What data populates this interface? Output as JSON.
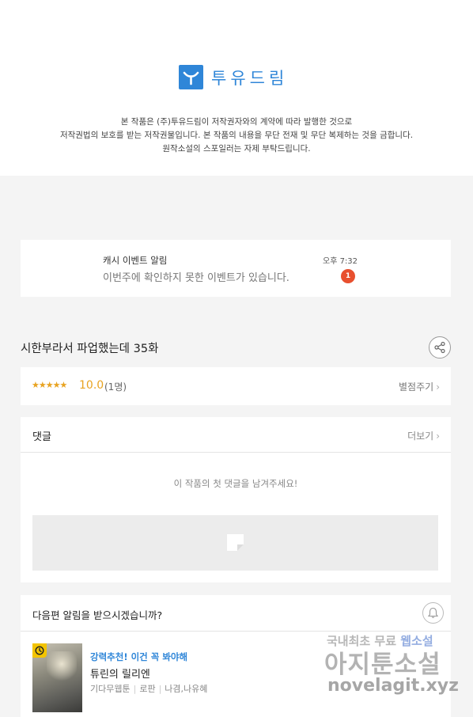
{
  "brand": {
    "logo_text": "투유드림",
    "color": "#2f86d8",
    "icon": "y-mark-icon"
  },
  "copyright": {
    "line1": "본 작품은 (주)투유드림이 저작권자와의 계약에 따라 발행한 것으로",
    "line2": "저작권법의 보호를 받는 저작권물입니다. 본 작품의 내용을 무단 전재 및 무단 복제하는 것을 금합니다.",
    "line3": "원작소설의 스포일러는 자제 부탁드립니다."
  },
  "notification": {
    "title": "캐시 이벤트 알림",
    "time": "오후 7:32",
    "message": "이번주에 확인하지 못한 이벤트가 있습니다.",
    "badge_count": "1",
    "badge_color": "#e8502f"
  },
  "episode": {
    "title": "시한부라서 파업했는데 35화",
    "share_icon": "share-icon"
  },
  "rating": {
    "stars": "★★★★★",
    "score": "10.0",
    "count": "(1명)",
    "rate_label": "별점주기",
    "star_color": "#e8a321"
  },
  "comments": {
    "title": "댓글",
    "more_label": "더보기",
    "empty_message": "이 작품의 첫 댓글을 남겨주세요!",
    "write_icon": "write-icon"
  },
  "next_alert": {
    "title": "다음편 알림을 받으시겠습니까?",
    "bell_icon": "bell-icon"
  },
  "recommendation": {
    "tag": "강력추천! 이건 꼭 봐야해",
    "title": "튜린의 릴리엔",
    "category": "기다무웹툰",
    "genre": "로판",
    "authors": "나겸,나유혜",
    "clock_icon": "clock-icon"
  },
  "watermark": {
    "line1_a": "국내최초 무료 ",
    "line1_b": "웹소설",
    "line2": "아지툰소설",
    "line3": "novelagit.xyz"
  }
}
